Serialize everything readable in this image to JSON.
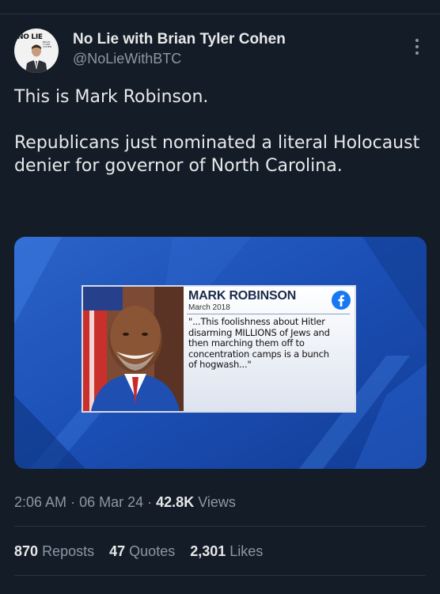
{
  "author": {
    "display_name": "No Lie with Brian Tyler Cohen",
    "handle": "@NoLieWithBTC",
    "avatar_logo": "NO LIE",
    "avatar_sub": "BRIAN TYLER COHEN"
  },
  "tweet": {
    "line1": "This is Mark Robinson.",
    "line2": "Republicans just nominated a literal Holocaust denier for governor of North Carolina."
  },
  "media": {
    "card_name": "MARK ROBINSON",
    "card_date": "March 2018",
    "card_quote": "\"...This foolishness about Hitler disarming MILLIONS of Jews and then marching them off to concentration camps is a bunch of hogwash...\"",
    "source_icon": "facebook-icon"
  },
  "meta": {
    "time": "2:06 AM",
    "date": "06 Mar 24",
    "separator": "·",
    "views_count": "42.8K",
    "views_label": "Views"
  },
  "stats": {
    "reposts_count": "870",
    "reposts_label": "Reposts",
    "quotes_count": "47",
    "quotes_label": "Quotes",
    "likes_count": "2,301",
    "likes_label": "Likes"
  },
  "colors": {
    "background": "#141c27",
    "text": "#e7e9ea",
    "muted": "#8b98a5",
    "facebook": "#1877f2"
  }
}
